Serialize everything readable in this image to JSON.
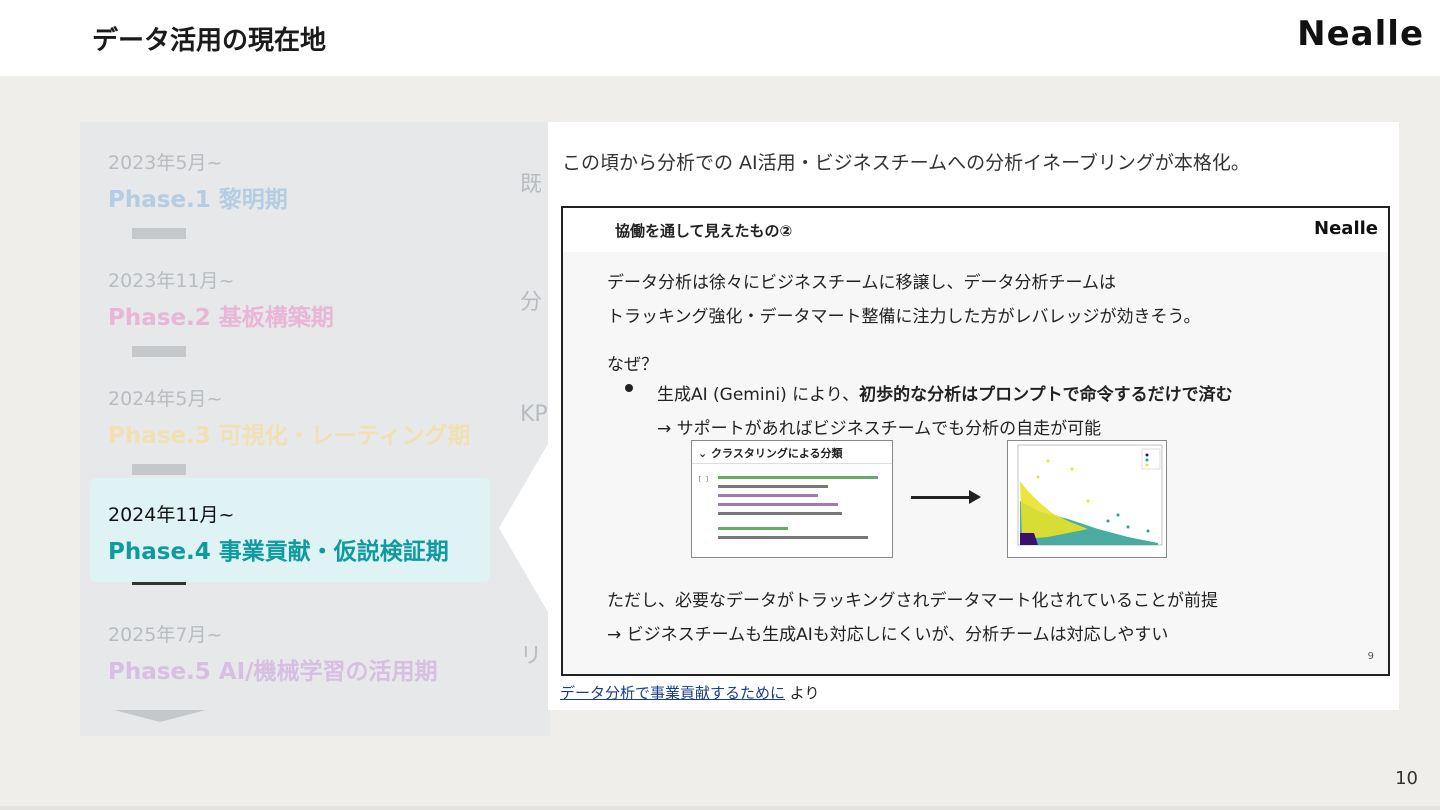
{
  "header": {
    "title": "データ活用の現在地",
    "brand": "Nealle"
  },
  "phases": [
    {
      "date": "2023年5月~",
      "name": "Phase.1 黎明期",
      "cut": "既",
      "color": "#b5cde3"
    },
    {
      "date": "2023年11月~",
      "name": "Phase.2 基板構築期",
      "cut": "分",
      "color": "#e8b6d6"
    },
    {
      "date": "2024年5月~",
      "name": "Phase.3 可視化・レーティング期",
      "cut": "KP",
      "color": "#f0e0b2"
    },
    {
      "date": "2024年11月~",
      "name": "Phase.4 事業貢献・仮説検証期",
      "cut": "",
      "color": "#0f9aa0"
    },
    {
      "date": "2025年7月~",
      "name": "Phase.5 AI/機械学習の活用期",
      "cut": "リ",
      "color": "#d6bfe0"
    }
  ],
  "panel": {
    "headline": "この頃から分析での AI活用・ビジネスチームへの分析イネーブリングが本格化。",
    "inner_title": "協働を通して見えたもの②",
    "inner_brand": "Nealle",
    "para1_line1": "データ分析は徐々にビジネスチームに移譲し、データ分析チームは",
    "para1_line2": "トラッキング強化・データマート整備に注力した方がレバレッジが効きそう。",
    "why": "なぜ？",
    "bullet_pre": "生成AI (Gemini) により、",
    "bullet_bold": "初歩的な分析はプロンプトで命令するだけで済む",
    "bullet_sub": "→ サポートがあればビジネスチームでも分析の自走が可能",
    "code_header": "⌄  クラスタリングによる分類",
    "caveat1": "ただし、必要なデータがトラッキングされデータマート化されていることが前提",
    "caveat2": "→ ビジネスチームも生成AIも対応しにくいが、分析チームは対応しやすい",
    "inner_page": "9",
    "source_link": "データ分析で事業貢献するために",
    "source_suffix": " より"
  },
  "slide_number": "10"
}
